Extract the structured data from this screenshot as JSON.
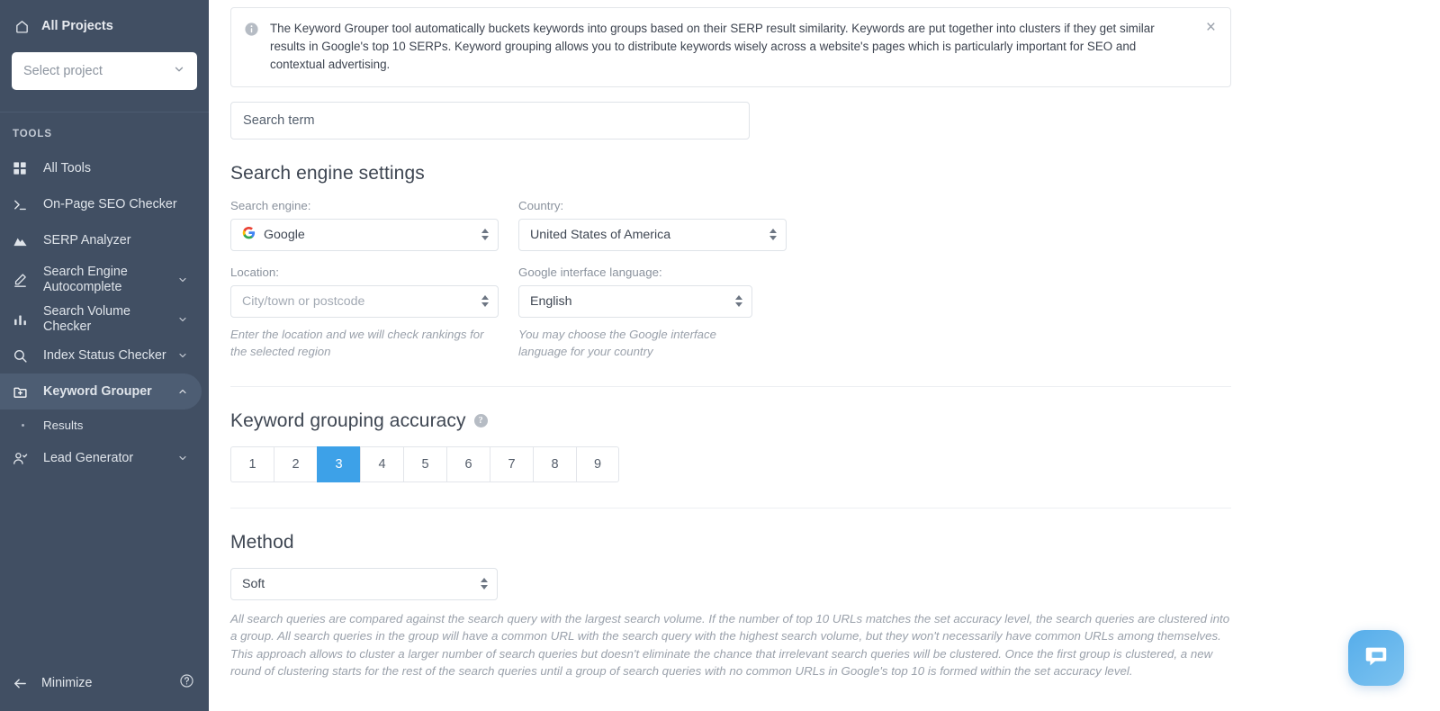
{
  "sidebar": {
    "all_projects_label": "All Projects",
    "project_select_placeholder": "Select project",
    "section_title": "TOOLS",
    "items": [
      {
        "label": "All Tools",
        "icon": "grid-icon",
        "has_chevron": false,
        "chevron": ""
      },
      {
        "label": "On-Page SEO Checker",
        "icon": "terminal-icon",
        "has_chevron": false,
        "chevron": ""
      },
      {
        "label": "SERP Analyzer",
        "icon": "mountain-icon",
        "has_chevron": false,
        "chevron": ""
      },
      {
        "label": "Search Engine Autocomplete",
        "icon": "pencil-icon",
        "has_chevron": true,
        "chevron": "⌄"
      },
      {
        "label": "Search Volume Checker",
        "icon": "bar-chart-icon",
        "has_chevron": true,
        "chevron": "⌄"
      },
      {
        "label": "Index Status Checker",
        "icon": "magnifier-icon",
        "has_chevron": true,
        "chevron": "⌄"
      },
      {
        "label": "Keyword Grouper",
        "icon": "folder-plus-icon",
        "has_chevron": true,
        "chevron": "⌃"
      },
      {
        "label": "Lead Generator",
        "icon": "user-check-icon",
        "has_chevron": true,
        "chevron": "⌄"
      }
    ],
    "sub_item_results": "Results",
    "minimize_label": "Minimize",
    "background_color": "#414f63",
    "active_item_color": "#4d5d73"
  },
  "notice": {
    "text": "The Keyword Grouper tool automatically buckets keywords into groups based on their SERP result similarity. Keywords are put together into clusters if they get similar results in Google's top 10 SERPs. Keyword grouping allows you to distribute keywords wisely across a website's pages which is particularly important for SEO and contextual advertising.",
    "close_label": "×",
    "icon": "info-icon"
  },
  "search_term": {
    "placeholder": "Search term",
    "value": ""
  },
  "search_engine_settings": {
    "heading": "Search engine settings",
    "search_engine": {
      "label": "Search engine:",
      "value": "Google",
      "icon": "google-icon"
    },
    "country": {
      "label": "Country:",
      "value": "United States of America"
    },
    "location": {
      "label": "Location:",
      "placeholder": "City/town or postcode",
      "value": "",
      "help": "Enter the location and we will check rankings for the selected region"
    },
    "interface_language": {
      "label": "Google interface language:",
      "value": "English",
      "help": "You may choose the Google interface language for your country"
    }
  },
  "accuracy": {
    "heading": "Keyword grouping accuracy",
    "help_icon": "question-mark-icon",
    "options": [
      "1",
      "2",
      "3",
      "4",
      "5",
      "6",
      "7",
      "8",
      "9"
    ],
    "selected": "3",
    "selected_color": "#3da1e8"
  },
  "method": {
    "heading": "Method",
    "value": "Soft",
    "description": "All search queries are compared against the search query with the largest search volume. If the number of top 10 URLs matches the set accuracy level, the search queries are clustered into a group. All search queries in the group will have a common URL with the search query with the highest search volume, but they won't necessarily have common URLs among themselves. This approach allows to cluster a larger number of search queries but doesn't eliminate the chance that irrelevant search queries will be clustered. Once the first group is clustered, a new round of clustering starts for the rest of the search queries until a group of search queries with no common URLs in Google's top 10 is formed within the set accuracy level."
  },
  "chat_widget": {
    "icon": "chat-bubble-icon",
    "color": "#56adea"
  }
}
